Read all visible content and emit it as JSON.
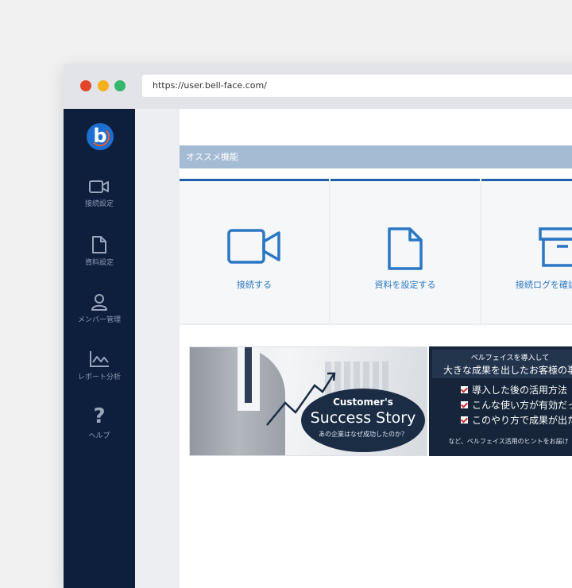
{
  "browser": {
    "url": "https://user.bell-face.com/"
  },
  "app": {
    "logo_letter": "b"
  },
  "sidebar": {
    "items": [
      {
        "label": "接続設定",
        "icon": "video-camera-icon"
      },
      {
        "label": "資料設定",
        "icon": "document-icon"
      },
      {
        "label": "メンバー管理",
        "icon": "user-icon"
      },
      {
        "label": "レポート分析",
        "icon": "chart-icon"
      },
      {
        "label": "ヘルプ",
        "icon": "help-icon"
      }
    ]
  },
  "main": {
    "section_title": "オススメ機能",
    "features": [
      {
        "label": "接続する",
        "icon": "video-camera-icon"
      },
      {
        "label": "資料を設定する",
        "icon": "document-icon"
      },
      {
        "label": "接続ログを確認",
        "icon": "archive-box-icon"
      }
    ],
    "banner": {
      "title_line1": "Customer's",
      "title_line2": "Success Story",
      "subtitle": "あの企業はなぜ成功したのか？",
      "right_header1": "ベルフェイスを導入して",
      "right_header2": "大きな成果を出したお客様の事",
      "bullets": [
        "導入した後の活用方法",
        "こんな使い方が有効だっ",
        "このやり方で成果が出た"
      ],
      "footer": "など、ベルフェイス活用のヒントをお届け"
    }
  },
  "colors": {
    "sidebar_bg": "#0e1f3d",
    "accent": "#2b77c4",
    "section_header_bg": "#a4bbd4"
  }
}
